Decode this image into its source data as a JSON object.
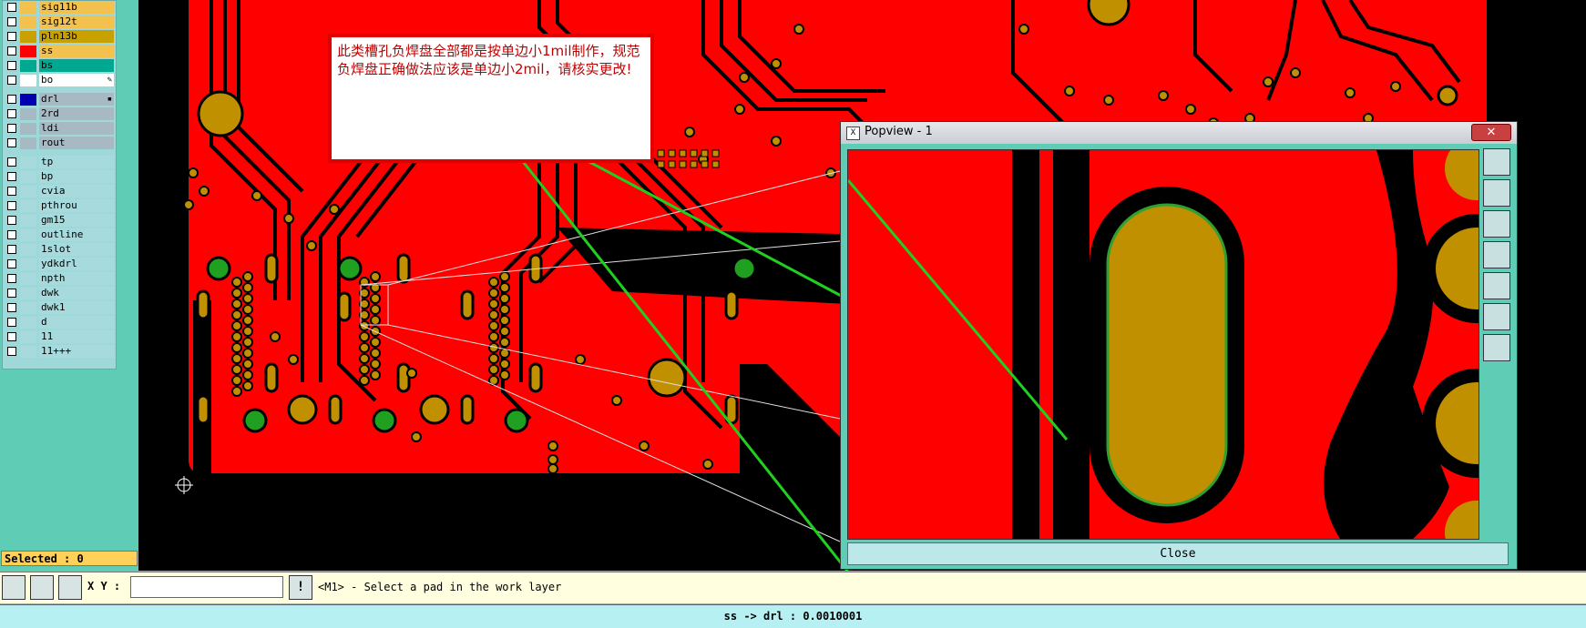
{
  "layers": [
    {
      "name": "sig11b",
      "color": "#f2c14e",
      "swatch": "#f2c14e"
    },
    {
      "name": "sig12t",
      "color": "#f2c14e",
      "swatch": "#f2c14e"
    },
    {
      "name": "pln13b",
      "color": "#c8a000",
      "swatch": "#c8a000"
    },
    {
      "name": "ss",
      "color": "#f2c14e",
      "swatch": "#ff0000"
    },
    {
      "name": "bs",
      "color": "#00a890",
      "swatch": "#00a890"
    },
    {
      "name": "bo",
      "color": "#ffffff",
      "swatch": "#ffffff",
      "marker": "✎"
    },
    {
      "name": "drl",
      "color": "#a7bac4",
      "swatch": "#0000b0",
      "marker": "▪"
    },
    {
      "name": "2rd",
      "color": "#a7bac4",
      "swatch": "#a7bac4"
    },
    {
      "name": "ldi",
      "color": "#a7bac4",
      "swatch": "#a7bac4"
    },
    {
      "name": "rout",
      "color": "#a7bac4",
      "swatch": "#a7bac4"
    },
    {
      "name": "tp",
      "color": "#a7dadd",
      "swatch": "#a7dadd"
    },
    {
      "name": "bp",
      "color": "#a7dadd",
      "swatch": "#a7dadd"
    },
    {
      "name": "cvia",
      "color": "#a7dadd",
      "swatch": "#a7dadd"
    },
    {
      "name": "pthrou",
      "color": "#a7dadd",
      "swatch": "#a7dadd"
    },
    {
      "name": "gm15",
      "color": "#a7dadd",
      "swatch": "#a7dadd"
    },
    {
      "name": "outline",
      "color": "#a7dadd",
      "swatch": "#a7dadd"
    },
    {
      "name": "1slot",
      "color": "#a7dadd",
      "swatch": "#a7dadd"
    },
    {
      "name": "ydkdrl",
      "color": "#a7dadd",
      "swatch": "#a7dadd"
    },
    {
      "name": "npth",
      "color": "#a7dadd",
      "swatch": "#a7dadd"
    },
    {
      "name": "dwk",
      "color": "#a7dadd",
      "swatch": "#a7dadd"
    },
    {
      "name": "dwk1",
      "color": "#a7dadd",
      "swatch": "#a7dadd"
    },
    {
      "name": "d",
      "color": "#a7dadd",
      "swatch": "#a7dadd"
    },
    {
      "name": "11",
      "color": "#a7dadd",
      "swatch": "#a7dadd"
    },
    {
      "name": "11+++",
      "color": "#a7dadd",
      "swatch": "#a7dadd"
    }
  ],
  "selected_label": "Selected : 0",
  "note_text": "此类槽孔负焊盘全部都是按单边小1mil制作，规范负焊盘正确做法应该是单边小2mil，请核实更改!",
  "popview": {
    "icon": "X",
    "title": "Popview - 1",
    "close_label": "Close",
    "close_x": "✕"
  },
  "cmdbar": {
    "xy_label": "X Y :",
    "xy_value": "",
    "excl": "!",
    "prompt": "<M1> - Select a pad in the work layer"
  },
  "status_text": "ss -> drl : 0.0010001",
  "colors": {
    "copper": "#ff0000",
    "pad": "#c09000",
    "trace": "#000000",
    "highlight": "#20c020"
  }
}
